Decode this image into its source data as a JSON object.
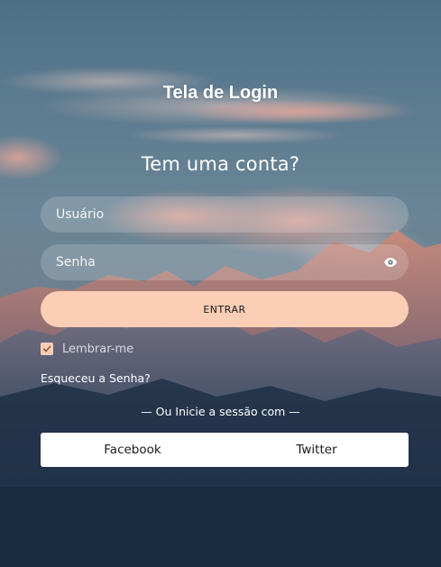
{
  "page": {
    "heading": "Tela de Login",
    "subheading": "Tem uma conta?"
  },
  "form": {
    "username_placeholder": "Usuário",
    "password_placeholder": "Senha",
    "submit_label": "ENTRAR",
    "remember_label": "Lembrar-me",
    "remember_checked": true,
    "forgot_label": "Esqueceu a Senha?"
  },
  "social": {
    "divider_label": "— Ou Inicie a sessão com —",
    "facebook_label": "Facebook",
    "twitter_label": "Twitter"
  },
  "icons": {
    "password_toggle": "eye-icon",
    "remember_check": "check-icon"
  },
  "colors": {
    "accent": "#fbceb5",
    "button_text": "#1a1a1a",
    "social_button_bg": "#ffffff"
  }
}
